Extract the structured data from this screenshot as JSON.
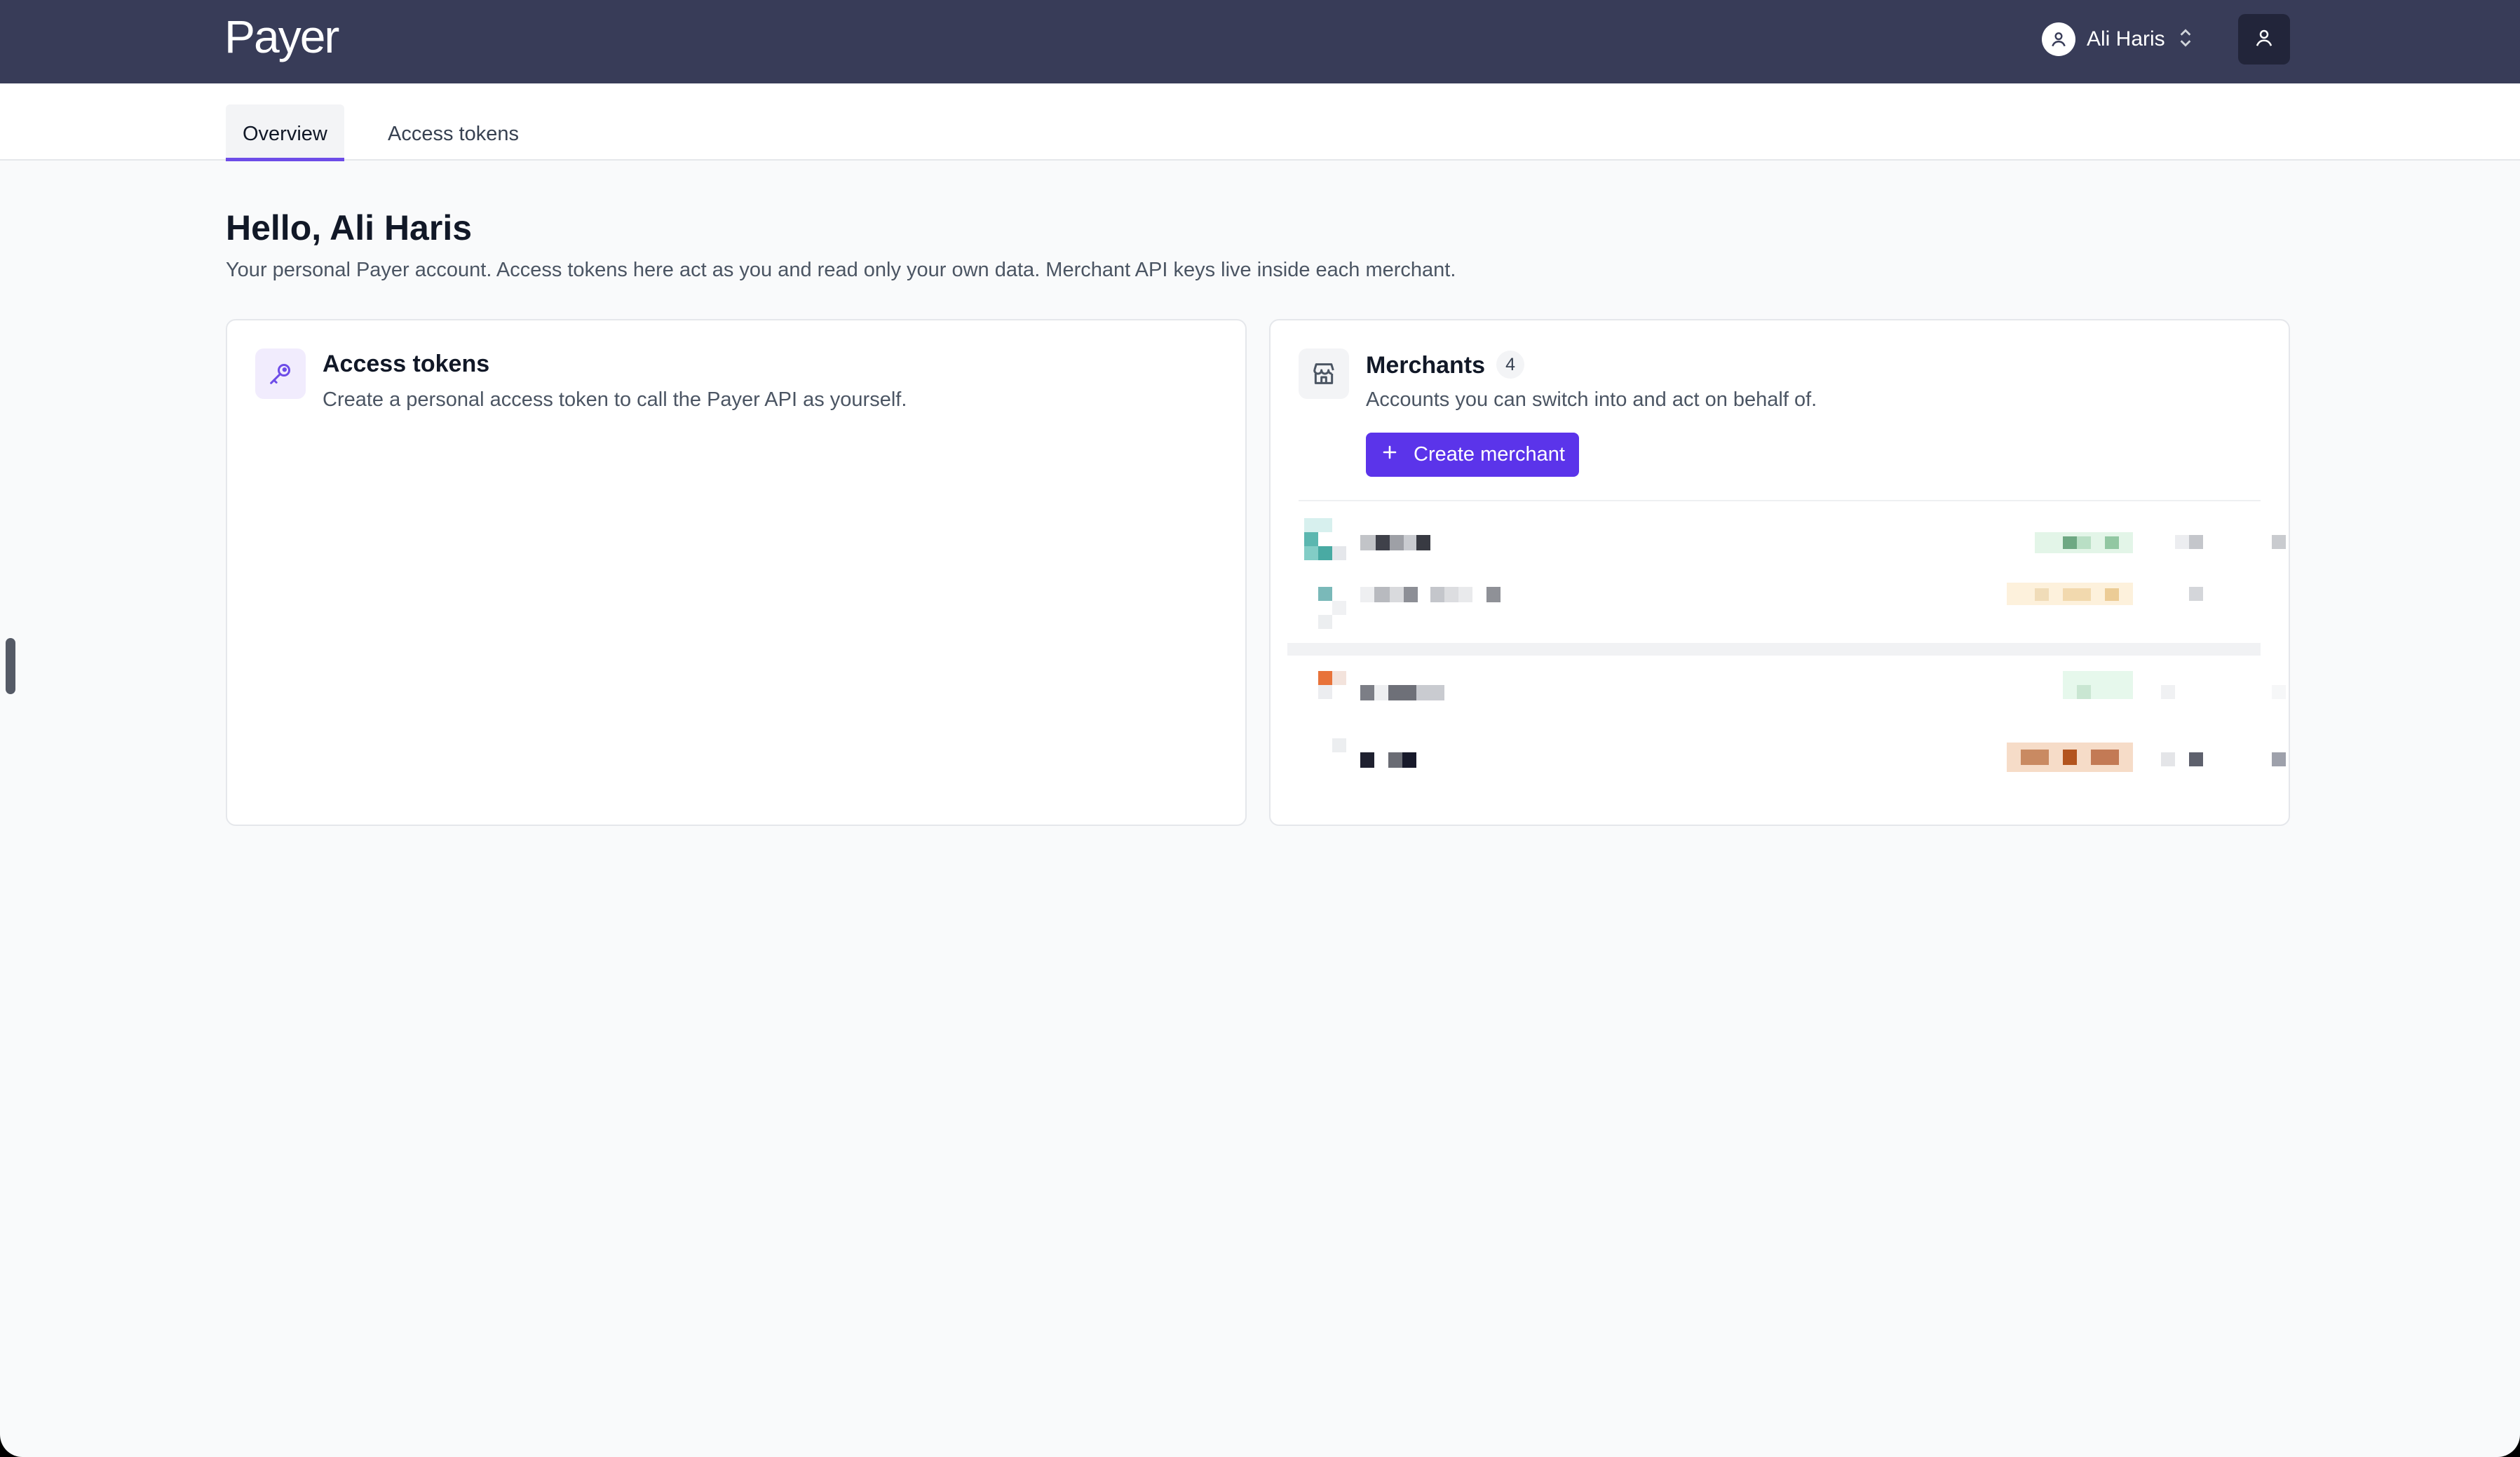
{
  "app": {
    "logo": "Payer",
    "user_name": "Ali Haris"
  },
  "icons": {
    "user_avatar": "user-icon",
    "switcher": "chevron-up-down-icon",
    "profile": "user-icon",
    "access_tokens": "key-icon",
    "merchants": "store-icon",
    "create": "plus-icon"
  },
  "colors": {
    "topbar": "#383c58",
    "accent": "#5b34ea",
    "tab_indicator": "#6d4ce8"
  },
  "tabs": [
    {
      "label": "Overview",
      "active": true
    },
    {
      "label": "Access tokens",
      "active": false
    }
  ],
  "main": {
    "greeting": "Hello, Ali Haris",
    "subtitle": "Your personal Payer account. Access tokens here act as you and read only your own data. Merchant API keys live inside each merchant."
  },
  "access_tokens_card": {
    "title": "Access tokens",
    "description": "Create a personal access token to call the Payer API as yourself."
  },
  "merchants_card": {
    "title": "Merchants",
    "count": "4",
    "description": "Accounts you can switch into and act on behalf of.",
    "create_label": "Create merchant",
    "rows": [
      {
        "status_color": "#e3f5e8"
      },
      {
        "status_color": "#fdf1dc"
      },
      {
        "status_color": "#e6f8ec"
      },
      {
        "status_color": "#f6dcc8"
      }
    ]
  }
}
